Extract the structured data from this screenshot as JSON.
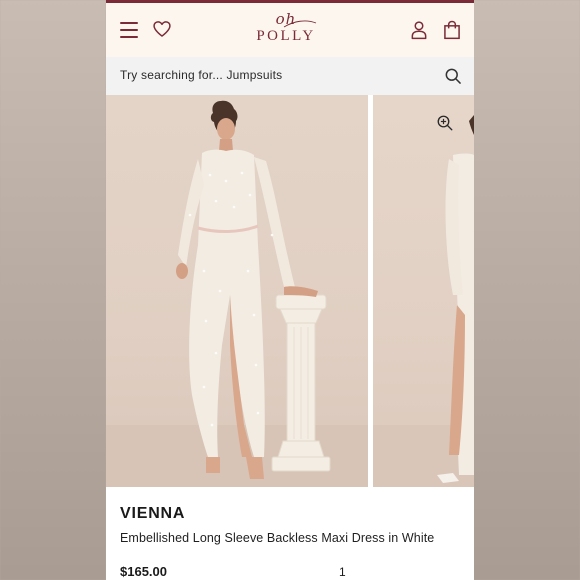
{
  "brand": {
    "logo_top": "oh",
    "logo_bottom": "POLLY",
    "accent_color": "#7a2b37"
  },
  "header": {
    "icons": [
      "menu-icon",
      "heart-icon",
      "account-icon",
      "bag-icon"
    ]
  },
  "search": {
    "prompt": "Try searching for...",
    "suggestion": "Jumpsuits",
    "icon": "search-icon"
  },
  "gallery": {
    "zoom_icon": "zoom-in-icon"
  },
  "product": {
    "name": "VIENNA",
    "description": "Embellished Long Sleeve Backless Maxi Dress in White",
    "price": "$165.00",
    "quantity": "1"
  }
}
